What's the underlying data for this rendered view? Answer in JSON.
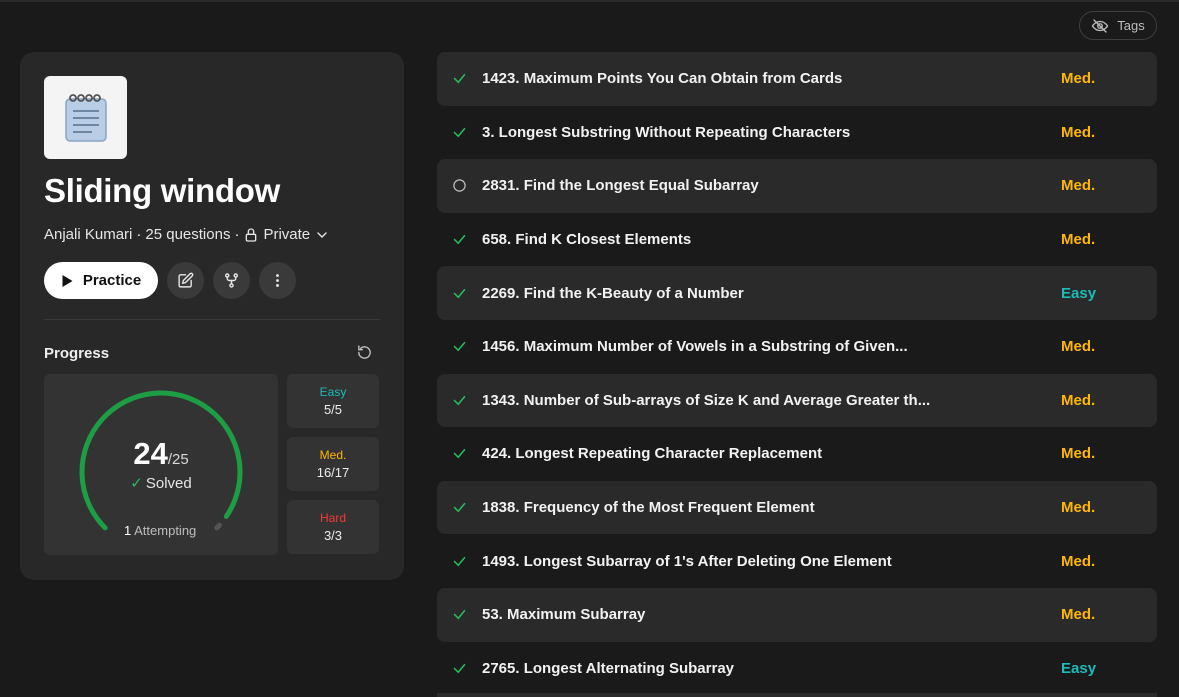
{
  "header": {
    "tags_label": "Tags"
  },
  "list": {
    "title": "Sliding window",
    "author": "Anjali Kumari",
    "sep1": "·",
    "question_count": "25 questions",
    "sep2": "·",
    "visibility": "Private",
    "practice_label": "Practice"
  },
  "progress": {
    "label": "Progress",
    "solved": "24",
    "total": "/25",
    "solved_label": "Solved",
    "attempting_count": "1",
    "attempting_label": "Attempting",
    "fraction_solved": 0.96,
    "difficulty": [
      {
        "label": "Easy",
        "value": "5/5",
        "color": "#1cbaba"
      },
      {
        "label": "Med.",
        "value": "16/17",
        "color": "#ffb700"
      },
      {
        "label": "Hard",
        "value": "3/3",
        "color": "#f63737"
      }
    ]
  },
  "colors": {
    "easy": "#1cbaba",
    "medium": "#ffb700",
    "hard": "#f63737",
    "solved": "#2cbb5d",
    "gauge": "#1e9e44"
  },
  "questions": [
    {
      "title": "1423. Maximum Points You Can Obtain from Cards",
      "difficulty": "Med.",
      "status": "solved"
    },
    {
      "title": "3. Longest Substring Without Repeating Characters",
      "difficulty": "Med.",
      "status": "solved"
    },
    {
      "title": "2831. Find the Longest Equal Subarray",
      "difficulty": "Med.",
      "status": "attempted"
    },
    {
      "title": "658. Find K Closest Elements",
      "difficulty": "Med.",
      "status": "solved"
    },
    {
      "title": "2269. Find the K-Beauty of a Number",
      "difficulty": "Easy",
      "status": "solved"
    },
    {
      "title": "1456. Maximum Number of Vowels in a Substring of Given...",
      "difficulty": "Med.",
      "status": "solved"
    },
    {
      "title": "1343. Number of Sub-arrays of Size K and Average Greater th...",
      "difficulty": "Med.",
      "status": "solved"
    },
    {
      "title": "424. Longest Repeating Character Replacement",
      "difficulty": "Med.",
      "status": "solved"
    },
    {
      "title": "1838. Frequency of the Most Frequent Element",
      "difficulty": "Med.",
      "status": "solved"
    },
    {
      "title": "1493. Longest Subarray of 1's After Deleting One Element",
      "difficulty": "Med.",
      "status": "solved"
    },
    {
      "title": "53. Maximum Subarray",
      "difficulty": "Med.",
      "status": "solved"
    },
    {
      "title": "2765. Longest Alternating Subarray",
      "difficulty": "Easy",
      "status": "solved"
    }
  ]
}
